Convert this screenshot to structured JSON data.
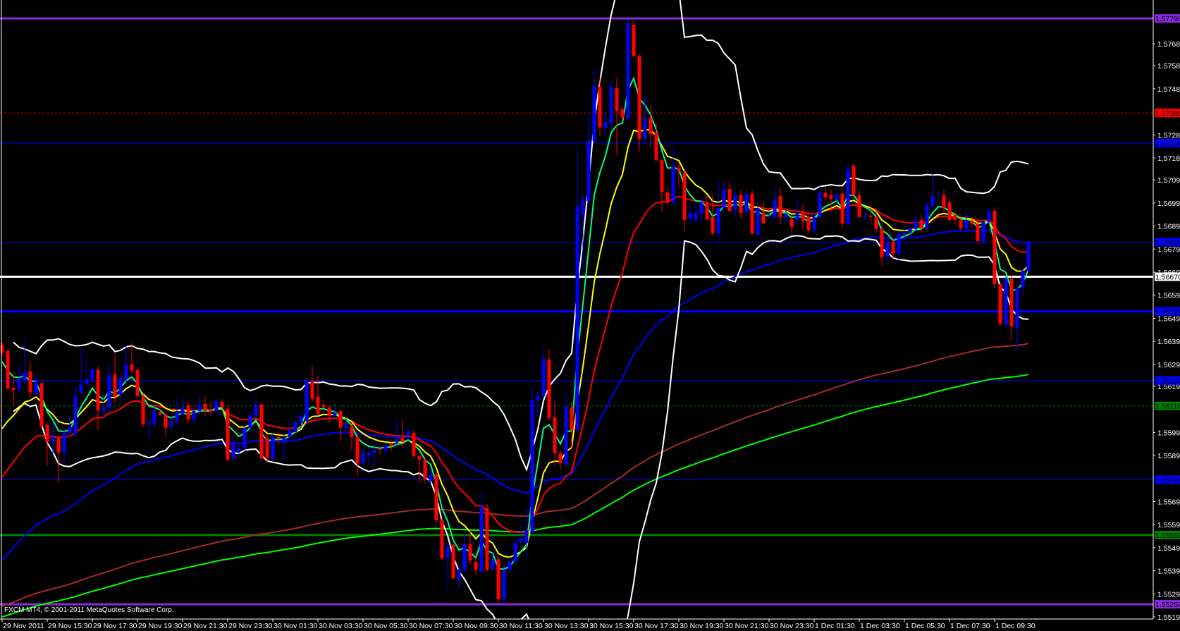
{
  "footer": {
    "copyright": "FXCM MT4, © 2001-2011 MetaQuotes Software Corp."
  },
  "colors": {
    "background": "#000000",
    "bull": "#0000ff",
    "bear": "#ff0000",
    "axis": "#ffffff"
  },
  "chart_data": {
    "type": "candlestick",
    "title": "",
    "bar_interval": "15 min",
    "first_bar": "29 Nov 2011 13:30",
    "ylim": [
      1.55186,
      1.5787
    ],
    "grid": false,
    "y_ticks": [
      "1.57680",
      "1.57585",
      "1.57485",
      "1.57285",
      "1.57185",
      "1.57090",
      "1.56990",
      "1.56890",
      "1.56790",
      "1.56690",
      "1.56590",
      "1.56490",
      "1.56390",
      "1.56290",
      "1.56195",
      "1.55995",
      "1.55895",
      "1.55695",
      "1.55595",
      "1.55495",
      "1.55395",
      "1.55295",
      "1.55195"
    ],
    "x_ticks": [
      {
        "bar": 0,
        "label": "29 Nov 2011"
      },
      {
        "bar": 8,
        "label": "29 Nov 15:30"
      },
      {
        "bar": 16,
        "label": "29 Nov 17:30"
      },
      {
        "bar": 24,
        "label": "29 Nov 19:30"
      },
      {
        "bar": 32,
        "label": "29 Nov 21:30"
      },
      {
        "bar": 40,
        "label": "29 Nov 23:30"
      },
      {
        "bar": 48,
        "label": "30 Nov 01:30"
      },
      {
        "bar": 56,
        "label": "30 Nov 03:30"
      },
      {
        "bar": 64,
        "label": "30 Nov 05:30"
      },
      {
        "bar": 72,
        "label": "30 Nov 07:30"
      },
      {
        "bar": 80,
        "label": "30 Nov 09:30"
      },
      {
        "bar": 88,
        "label": "30 Nov 11:30"
      },
      {
        "bar": 96,
        "label": "30 Nov 13:30"
      },
      {
        "bar": 104,
        "label": "30 Nov 15:30"
      },
      {
        "bar": 112,
        "label": "30 Nov 17:30"
      },
      {
        "bar": 120,
        "label": "30 Nov 19:30"
      },
      {
        "bar": 128,
        "label": "30 Nov 21:30"
      },
      {
        "bar": 136,
        "label": "30 Nov 23:30"
      },
      {
        "bar": 144,
        "label": "1 Dec 01:30"
      },
      {
        "bar": 152,
        "label": "1 Dec 03:30"
      },
      {
        "bar": 160,
        "label": "1 Dec 05:30"
      },
      {
        "bar": 168,
        "label": "1 Dec 07:30"
      },
      {
        "bar": 176,
        "label": "1 Dec 09:30"
      }
    ],
    "levels": [
      {
        "price": "1.57790",
        "color": "#8a2be2",
        "style": "thick"
      },
      {
        "price": "1.57380",
        "color": "#ff0000",
        "style": "dashed"
      },
      {
        "price": "1.57250",
        "color": "#0000ff",
        "style": "thin"
      },
      {
        "price": "1.56820",
        "color": "#0000ff",
        "style": "thin"
      },
      {
        "price": "1.56670",
        "color": "#ffffff",
        "style": "thick"
      },
      {
        "price": "1.56520",
        "color": "#0000ff",
        "style": "thick"
      },
      {
        "price": "1.56220",
        "color": "#0000ff",
        "style": "thin"
      },
      {
        "price": "1.56110",
        "color": "#008000",
        "style": "dashed"
      },
      {
        "price": "1.55790",
        "color": "#0000ff",
        "style": "thin"
      },
      {
        "price": "1.55550",
        "color": "#008000",
        "style": "thick"
      },
      {
        "price": "1.55250",
        "color": "#8a2be2",
        "style": "thick"
      }
    ],
    "indicators": [
      {
        "type": "EMA",
        "period": 200,
        "color": "#a52a2a",
        "initial": 1.55241
      },
      {
        "type": "EMA",
        "period": 250,
        "color": "#00ff00",
        "initial": 1.55195
      },
      {
        "type": "EMA",
        "period": 55,
        "color": "#0000ff",
        "initial": 1.55443
      },
      {
        "type": "Bollinger",
        "period": 20,
        "deviation": 2,
        "color": "#ffffff"
      },
      {
        "type": "EMA",
        "period": 21,
        "color": "#ff0000",
        "initial": 1.558
      },
      {
        "type": "EMA",
        "period": 10,
        "color": "#ffff00",
        "initial": 1.56012
      },
      {
        "type": "EMA",
        "period": 5,
        "color": "#00ff80",
        "initial": 1.56302
      }
    ],
    "ohlc": [
      [
        1.56374,
        1.56387,
        1.56327,
        1.56342
      ],
      [
        1.56348,
        1.56357,
        1.56174,
        1.56186
      ],
      [
        1.56189,
        1.56257,
        1.56113,
        1.5618
      ],
      [
        1.56183,
        1.56287,
        1.56168,
        1.56229
      ],
      [
        1.5622,
        1.56393,
        1.56205,
        1.56257
      ],
      [
        1.5626,
        1.56302,
        1.56144,
        1.56168
      ],
      [
        1.56161,
        1.5625,
        1.5615,
        1.56217
      ],
      [
        1.56208,
        1.5622,
        1.56015,
        1.56021
      ],
      [
        1.56027,
        1.56036,
        1.55853,
        1.55954
      ],
      [
        1.55954,
        1.56036,
        1.55899,
        1.55975
      ],
      [
        1.55969,
        1.55981,
        1.55776,
        1.55908
      ],
      [
        1.55911,
        1.56005,
        1.55862,
        1.55993
      ],
      [
        1.55993,
        1.56067,
        1.55975,
        1.56021
      ],
      [
        1.5599,
        1.56189,
        1.55981,
        1.56153
      ],
      [
        1.56168,
        1.56363,
        1.56159,
        1.56205
      ],
      [
        1.56205,
        1.56324,
        1.56196,
        1.56226
      ],
      [
        1.5622,
        1.56278,
        1.56205,
        1.56269
      ],
      [
        1.56266,
        1.56281,
        1.56005,
        1.56091
      ],
      [
        1.56088,
        1.56159,
        1.56052,
        1.56104
      ],
      [
        1.56104,
        1.56293,
        1.56082,
        1.56244
      ],
      [
        1.56247,
        1.56333,
        1.56122,
        1.5615
      ],
      [
        1.56159,
        1.5625,
        1.56128,
        1.56232
      ],
      [
        1.56226,
        1.56372,
        1.56205,
        1.56287
      ],
      [
        1.5629,
        1.56384,
        1.5625,
        1.56263
      ],
      [
        1.56266,
        1.56281,
        1.56144,
        1.56153
      ],
      [
        1.56153,
        1.56165,
        1.56021,
        1.5603
      ],
      [
        1.5603,
        1.56052,
        1.55969,
        1.56036
      ],
      [
        1.5603,
        1.56104,
        1.56021,
        1.56088
      ],
      [
        1.56082,
        1.56097,
        1.56067,
        1.56073
      ],
      [
        1.56073,
        1.56082,
        1.55975,
        1.56015
      ],
      [
        1.56021,
        1.56067,
        1.55999,
        1.56039
      ],
      [
        1.56042,
        1.56141,
        1.5603,
        1.56088
      ],
      [
        1.56076,
        1.56144,
        1.56067,
        1.56107
      ],
      [
        1.56113,
        1.56128,
        1.56036,
        1.56052
      ],
      [
        1.56052,
        1.56113,
        1.5603,
        1.56088
      ],
      [
        1.56088,
        1.56159,
        1.56073,
        1.56113
      ],
      [
        1.56119,
        1.5615,
        1.56067,
        1.56088
      ],
      [
        1.56097,
        1.56128,
        1.56067,
        1.56085
      ],
      [
        1.56088,
        1.56144,
        1.56079,
        1.56131
      ],
      [
        1.56128,
        1.56141,
        1.56097,
        1.56104
      ],
      [
        1.56097,
        1.56113,
        1.55868,
        1.55877
      ],
      [
        1.55883,
        1.55975,
        1.55868,
        1.55954
      ],
      [
        1.55914,
        1.55944,
        1.5589,
        1.55929
      ],
      [
        1.55926,
        1.5603,
        1.55914,
        1.56015
      ],
      [
        1.56015,
        1.56088,
        1.55999,
        1.56069
      ],
      [
        1.56067,
        1.5615,
        1.56052,
        1.56116
      ],
      [
        1.56116,
        1.56128,
        1.55871,
        1.55883
      ],
      [
        1.55972,
        1.5599,
        1.55865,
        1.55886
      ],
      [
        1.55883,
        1.5599,
        1.55868,
        1.55975
      ],
      [
        1.55975,
        1.55999,
        1.55944,
        1.55966
      ],
      [
        1.55951,
        1.5599,
        1.55877,
        1.55969
      ],
      [
        1.55975,
        1.56036,
        1.5596,
        1.56005
      ],
      [
        1.55996,
        1.56052,
        1.55981,
        1.56039
      ],
      [
        1.56036,
        1.56082,
        1.56021,
        1.56067
      ],
      [
        1.56045,
        1.56226,
        1.56036,
        1.5622
      ],
      [
        1.56217,
        1.56283,
        1.56128,
        1.56141
      ],
      [
        1.5615,
        1.56241,
        1.56067,
        1.56076
      ],
      [
        1.56113,
        1.56135,
        1.56082,
        1.56104
      ],
      [
        1.56104,
        1.56113,
        1.56036,
        1.56067
      ],
      [
        1.56067,
        1.56107,
        1.56052,
        1.56079
      ],
      [
        1.56088,
        1.56097,
        1.5596,
        1.56015
      ],
      [
        1.56015,
        1.56061,
        1.55999,
        1.5603
      ],
      [
        1.56021,
        1.56036,
        1.55914,
        1.55975
      ],
      [
        1.55975,
        1.5599,
        1.55807,
        1.55862
      ],
      [
        1.55862,
        1.55926,
        1.55853,
        1.55905
      ],
      [
        1.55896,
        1.55929,
        1.55853,
        1.55908
      ],
      [
        1.55905,
        1.55944,
        1.55847,
        1.5592
      ],
      [
        1.55923,
        1.55935,
        1.55899,
        1.5592
      ],
      [
        1.5592,
        1.55951,
        1.5589,
        1.55938
      ],
      [
        1.55944,
        1.5596,
        1.55914,
        1.55935
      ],
      [
        1.55951,
        1.56048,
        1.55938,
        1.55966
      ],
      [
        1.55972,
        1.56052,
        1.55929,
        1.55954
      ],
      [
        1.55984,
        1.56018,
        1.5596,
        1.55999
      ],
      [
        1.55993,
        1.56005,
        1.55883,
        1.55893
      ],
      [
        1.55893,
        1.55914,
        1.55776,
        1.55877
      ],
      [
        1.55877,
        1.5589,
        1.55773,
        1.55791
      ],
      [
        1.55785,
        1.55838,
        1.55776,
        1.55813
      ],
      [
        1.55813,
        1.55822,
        1.55602,
        1.55614
      ],
      [
        1.55614,
        1.55623,
        1.5544,
        1.55449
      ],
      [
        1.55449,
        1.55516,
        1.55296,
        1.55501
      ],
      [
        1.55507,
        1.55516,
        1.55357,
        1.55363
      ],
      [
        1.55357,
        1.55424,
        1.55317,
        1.554
      ],
      [
        1.554,
        1.55556,
        1.55387,
        1.5551
      ],
      [
        1.5551,
        1.55571,
        1.55424,
        1.5544
      ],
      [
        1.55434,
        1.55455,
        1.55378,
        1.554
      ],
      [
        1.55393,
        1.55736,
        1.55387,
        1.55671
      ],
      [
        1.55669,
        1.55684,
        1.55387,
        1.554
      ],
      [
        1.55403,
        1.5547,
        1.55393,
        1.55446
      ],
      [
        1.55446,
        1.55455,
        1.55256,
        1.55271
      ],
      [
        1.55271,
        1.55424,
        1.55256,
        1.554
      ],
      [
        1.554,
        1.55455,
        1.55387,
        1.55434
      ],
      [
        1.55434,
        1.55532,
        1.55424,
        1.55516
      ],
      [
        1.55516,
        1.55593,
        1.55501,
        1.55538
      ],
      [
        1.55516,
        1.55669,
        1.55455,
        1.55571
      ],
      [
        1.55562,
        1.56196,
        1.55553,
        1.56135
      ],
      [
        1.56135,
        1.56174,
        1.56067,
        1.56153
      ],
      [
        1.56153,
        1.56372,
        1.56144,
        1.56314
      ],
      [
        1.56311,
        1.56357,
        1.56045,
        1.56058
      ],
      [
        1.56061,
        1.56128,
        1.55853,
        1.55905
      ],
      [
        1.55905,
        1.5592,
        1.55832,
        1.55862
      ],
      [
        1.55859,
        1.56159,
        1.55847,
        1.56107
      ],
      [
        1.56104,
        1.56128,
        1.55923,
        1.56005
      ],
      [
        1.56005,
        1.57222,
        1.55999,
        1.56977
      ],
      [
        1.56938,
        1.5703,
        1.56699,
        1.57005
      ],
      [
        1.56999,
        1.57372,
        1.56984,
        1.57259
      ],
      [
        1.57259,
        1.5757,
        1.57244,
        1.57497
      ],
      [
        1.57494,
        1.57534,
        1.5728,
        1.57317
      ],
      [
        1.57314,
        1.5739,
        1.57274,
        1.57341
      ],
      [
        1.57335,
        1.57519,
        1.57305,
        1.57494
      ],
      [
        1.57488,
        1.57534,
        1.57198,
        1.5739
      ],
      [
        1.57396,
        1.57411,
        1.57344,
        1.57359
      ],
      [
        1.57359,
        1.57784,
        1.5735,
        1.57769
      ],
      [
        1.57763,
        1.57784,
        1.57619,
        1.57628
      ],
      [
        1.57628,
        1.57638,
        1.57213,
        1.57268
      ],
      [
        1.57268,
        1.57451,
        1.57244,
        1.57357
      ],
      [
        1.57359,
        1.57411,
        1.57228,
        1.57289
      ],
      [
        1.57295,
        1.57335,
        1.57167,
        1.57176
      ],
      [
        1.57176,
        1.57183,
        1.56953,
        1.57036
      ],
      [
        1.57036,
        1.57061,
        1.56984,
        1.5699
      ],
      [
        1.5699,
        1.57235,
        1.56984,
        1.57146
      ],
      [
        1.57143,
        1.57167,
        1.57061,
        1.57128
      ],
      [
        1.57122,
        1.57137,
        1.56868,
        1.56916
      ],
      [
        1.56922,
        1.56984,
        1.56898,
        1.56947
      ],
      [
        1.56916,
        1.56984,
        1.56898,
        1.56947
      ],
      [
        1.56941,
        1.57014,
        1.56907,
        1.56993
      ],
      [
        1.5699,
        1.5702,
        1.56916,
        1.56919
      ],
      [
        1.56929,
        1.5703,
        1.56846,
        1.56858
      ],
      [
        1.56858,
        1.57082,
        1.56822,
        1.56968
      ],
      [
        1.56968,
        1.57082,
        1.56953,
        1.57048
      ],
      [
        1.57051,
        1.57082,
        1.56947,
        1.56956
      ],
      [
        1.56959,
        1.57045,
        1.56929,
        1.57024
      ],
      [
        1.57024,
        1.57045,
        1.56922,
        1.56947
      ],
      [
        1.5695,
        1.57051,
        1.56938,
        1.5703
      ],
      [
        1.5703,
        1.57045,
        1.56852,
        1.56858
      ],
      [
        1.56852,
        1.56999,
        1.56846,
        1.56968
      ],
      [
        1.56947,
        1.56999,
        1.56898,
        1.56901
      ],
      [
        1.56929,
        1.56953,
        1.56922,
        1.56932
      ],
      [
        1.56929,
        1.57061,
        1.56922,
        1.57005
      ],
      [
        1.5702,
        1.57055,
        1.56898,
        1.56929
      ],
      [
        1.56929,
        1.56968,
        1.56907,
        1.56944
      ],
      [
        1.56919,
        1.56938,
        1.56861,
        1.56886
      ],
      [
        1.56916,
        1.56999,
        1.56898,
        1.56947
      ],
      [
        1.56953,
        1.56984,
        1.56877,
        1.56913
      ],
      [
        1.56929,
        1.56953,
        1.56861,
        1.56871
      ],
      [
        1.56871,
        1.56953,
        1.56861,
        1.56929
      ],
      [
        1.56929,
        1.57067,
        1.56922,
        1.57036
      ],
      [
        1.57033,
        1.57061,
        1.56999,
        1.57014
      ],
      [
        1.57024,
        1.57045,
        1.56953,
        1.57008
      ],
      [
        1.57005,
        1.57045,
        1.56984,
        1.57027
      ],
      [
        1.5703,
        1.57051,
        1.56877,
        1.56901
      ],
      [
        1.56898,
        1.57158,
        1.56883,
        1.57137
      ],
      [
        1.57152,
        1.57161,
        1.57014,
        1.57024
      ],
      [
        1.57024,
        1.57045,
        1.56922,
        1.56929
      ],
      [
        1.56929,
        1.56953,
        1.56916,
        1.56932
      ],
      [
        1.56935,
        1.56984,
        1.56907,
        1.56929
      ],
      [
        1.56929,
        1.56953,
        1.56861,
        1.56877
      ],
      [
        1.56877,
        1.56892,
        1.56718,
        1.56755
      ],
      [
        1.56755,
        1.56846,
        1.56724,
        1.56822
      ],
      [
        1.56822,
        1.5684,
        1.56746,
        1.5677
      ],
      [
        1.5677,
        1.56868,
        1.56733,
        1.56855
      ],
      [
        1.56852,
        1.56892,
        1.56837,
        1.56864
      ],
      [
        1.56861,
        1.56907,
        1.56846,
        1.56877
      ],
      [
        1.56877,
        1.56938,
        1.56861,
        1.56913
      ],
      [
        1.56916,
        1.56938,
        1.56868,
        1.5688
      ],
      [
        1.5688,
        1.56999,
        1.56877,
        1.56977
      ],
      [
        1.56977,
        1.57116,
        1.56968,
        1.5702
      ],
      [
        1.57024,
        1.57045,
        1.57008,
        1.57027
      ],
      [
        1.57024,
        1.57045,
        1.56953,
        1.56968
      ],
      [
        1.56993,
        1.57014,
        1.56907,
        1.56916
      ],
      [
        1.56938,
        1.56953,
        1.56898,
        1.56916
      ],
      [
        1.56916,
        1.56938,
        1.56868,
        1.5688
      ],
      [
        1.56877,
        1.56953,
        1.56861,
        1.56916
      ],
      [
        1.56913,
        1.56929,
        1.56886,
        1.56898
      ],
      [
        1.56898,
        1.56922,
        1.56813,
        1.56825
      ],
      [
        1.56822,
        1.56922,
        1.5681,
        1.56907
      ],
      [
        1.56907,
        1.56971,
        1.56898,
        1.56956
      ],
      [
        1.56956,
        1.56971,
        1.56623,
        1.56638
      ],
      [
        1.56638,
        1.56647,
        1.56458,
        1.56466
      ],
      [
        1.56464,
        1.56671,
        1.5644,
        1.56662
      ],
      [
        1.56662,
        1.56677,
        1.56396,
        1.56455
      ],
      [
        1.56449,
        1.56632,
        1.56357,
        1.56623
      ],
      [
        1.56626,
        1.56708,
        1.56586,
        1.56696
      ],
      [
        1.56696,
        1.56831,
        1.5669,
        1.56818
      ]
    ]
  }
}
